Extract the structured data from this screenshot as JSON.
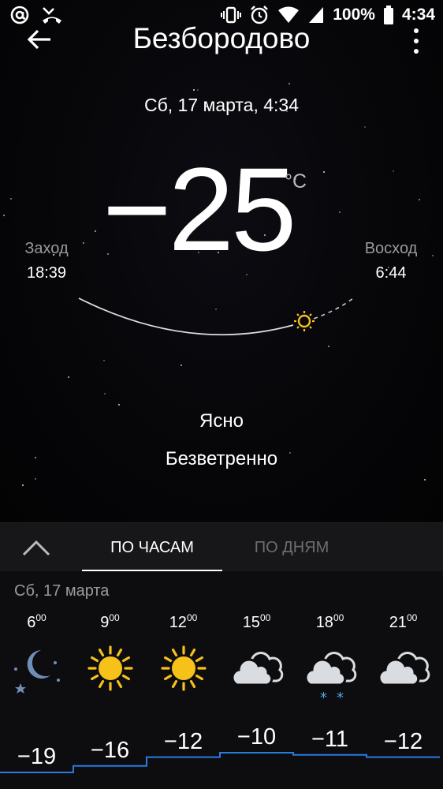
{
  "status_bar": {
    "battery": "100%",
    "time": "4:34"
  },
  "header": {
    "title": "Безбородово"
  },
  "current": {
    "datetime": "Сб, 17 марта, 4:34",
    "temperature": "−25",
    "unit": "°C",
    "sunset_label": "Заход",
    "sunset_time": "18:39",
    "sunrise_label": "Восход",
    "sunrise_time": "6:44",
    "condition": "Ясно",
    "wind": "Безветренно"
  },
  "tabs": [
    {
      "label": "ПО ЧАСАМ",
      "active": true
    },
    {
      "label": "ПО ДНЯМ",
      "active": false
    }
  ],
  "forecast": {
    "date": "Сб, 17 марта",
    "hours": [
      {
        "hour": "6",
        "minutes": "00",
        "icon": "moon-stars-icon",
        "temp": "−19",
        "value": -19
      },
      {
        "hour": "9",
        "minutes": "00",
        "icon": "sun-icon",
        "temp": "−16",
        "value": -16
      },
      {
        "hour": "12",
        "minutes": "00",
        "icon": "sun-icon",
        "temp": "−12",
        "value": -12
      },
      {
        "hour": "15",
        "minutes": "00",
        "icon": "cloud-icon",
        "temp": "−10",
        "value": -10
      },
      {
        "hour": "18",
        "minutes": "00",
        "icon": "cloud-snow-icon",
        "temp": "−11",
        "value": -11
      },
      {
        "hour": "21",
        "minutes": "00",
        "icon": "cloud-icon",
        "temp": "−12",
        "value": -12
      }
    ]
  },
  "colors": {
    "accent": "#2a7ae2",
    "sun": "#f6c21a",
    "moon": "#6f8fb8",
    "cloud": "#d9dde2",
    "snow": "#4aa8e8"
  }
}
